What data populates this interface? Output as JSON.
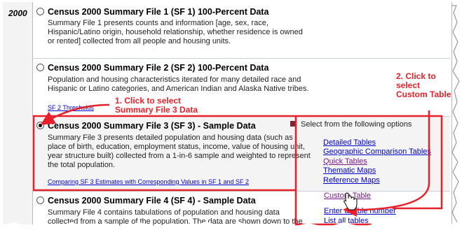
{
  "year": "2000",
  "sections": [
    {
      "title": "Census 2000 Summary File 1 (SF 1) 100-Percent Data",
      "selected": false,
      "description_lines": [
        "Summary File 1 presents counts and information [age, sex, race,",
        "Hispanic/Latino origin, household relationship, whether residence is owned",
        "or rented] collected from all people and housing units."
      ]
    },
    {
      "title": "Census 2000 Summary File 2 (SF 2) 100-Percent Data",
      "selected": false,
      "description_lines": [
        "Population and housing characteristics iterated for many detailed race and",
        "Hispanic or Latino categories, and American Indian and Alaska Native tribes."
      ],
      "link": "SF 2 Thresholds"
    },
    {
      "title": "Census 2000 Summary File 3 (SF 3) - Sample Data",
      "selected": true,
      "description_lines": [
        "Summary File 3 presents detailed population and housing data (such as",
        "place of birth, education, employment status, income, value of housing unit,",
        "year structure built) collected from a 1-in-6 sample and weighted to represent",
        "the total population."
      ],
      "link": "Comparing SF 3 Estimates with Corresponding Values in SF 1 and SF 2"
    },
    {
      "title": "Census 2000 Summary File 4 (SF 4) - Sample Data",
      "selected": false,
      "description_lines": [
        "Summary File 4 contains tabulations of population and housing data",
        "collected from a sample of the population. The data are shown down to the"
      ]
    }
  ],
  "options": {
    "heading": "Select from the following options",
    "heading_marker_color": "#7a2432",
    "items": [
      "Detailed Tables",
      "Geographic Comparison Tables",
      "Quick Tables",
      "Thematic Maps",
      "Reference Maps",
      "Custom Table",
      "Enter a table number",
      "List all tables"
    ]
  },
  "annotations": {
    "step1_line1": "1. Click to select",
    "step1_line2": "Summary File 3 Data",
    "step2_line1": "2. Click to",
    "step2_line2": "select",
    "step2_line3": "Custom Table",
    "color": "#e8202a"
  }
}
